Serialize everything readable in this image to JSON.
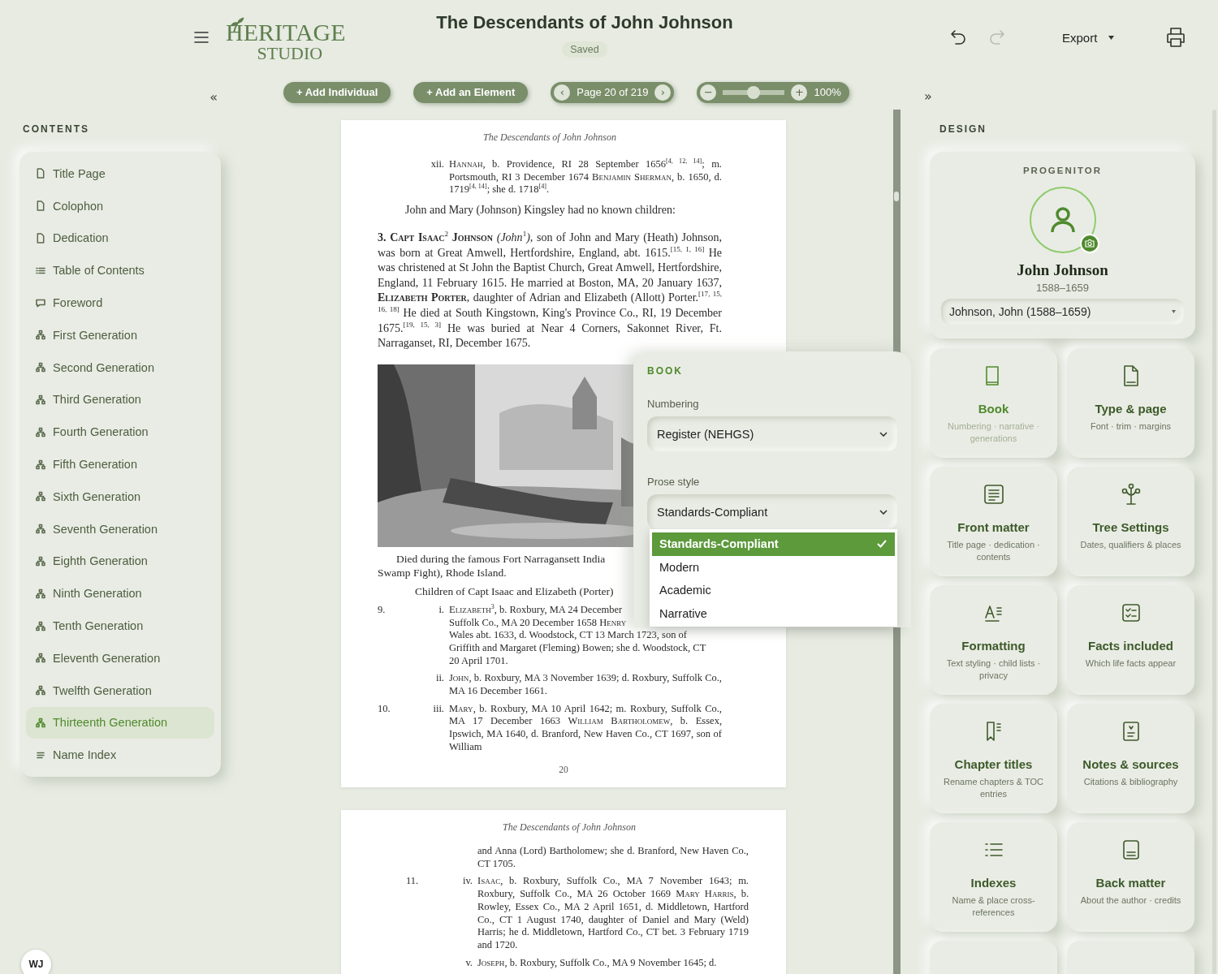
{
  "header": {
    "title": "The Descendants of John Johnson",
    "status": "Saved",
    "logo": {
      "line1": "HERITAGE",
      "line2": "STUDIO"
    },
    "undo": {
      "disabled": false
    },
    "redo": {
      "disabled": true
    },
    "export": "Export"
  },
  "toolbar": {
    "collapse_left": "«",
    "add_individual": "+ Add Individual",
    "add_element": "+ Add an Element",
    "page_prev": "‹",
    "page_label": "Page 20 of 219",
    "page_next": "›",
    "zoom_out": "−",
    "zoom": {
      "level": 0.49
    },
    "zoom_in": "+",
    "zoom_reading": "100%",
    "expand_right": "»"
  },
  "contents": {
    "title": "CONTENTS",
    "items": [
      {
        "label": "Title Page",
        "kind": "page",
        "selected": false
      },
      {
        "label": "Colophon",
        "kind": "page",
        "selected": false
      },
      {
        "label": "Dedication",
        "kind": "page",
        "selected": false
      },
      {
        "label": "Table of Contents",
        "kind": "toc",
        "selected": false
      },
      {
        "label": "Foreword",
        "kind": "comment",
        "selected": false
      },
      {
        "label": "First Generation",
        "kind": "generation",
        "selected": false
      },
      {
        "label": "Second Generation",
        "kind": "generation",
        "selected": false
      },
      {
        "label": "Third Generation",
        "kind": "generation",
        "selected": false
      },
      {
        "label": "Fourth Generation",
        "kind": "generation",
        "selected": false
      },
      {
        "label": "Fifth Generation",
        "kind": "generation",
        "selected": false
      },
      {
        "label": "Sixth Generation",
        "kind": "generation",
        "selected": false
      },
      {
        "label": "Seventh Generation",
        "kind": "generation",
        "selected": false
      },
      {
        "label": "Eighth Generation",
        "kind": "generation",
        "selected": false
      },
      {
        "label": "Ninth Generation",
        "kind": "generation",
        "selected": false
      },
      {
        "label": "Tenth Generation",
        "kind": "generation",
        "selected": false
      },
      {
        "label": "Eleventh Generation",
        "kind": "generation",
        "selected": false
      },
      {
        "label": "Twelfth Generation",
        "kind": "generation",
        "selected": false
      },
      {
        "label": "Thirteenth Generation",
        "kind": "generation",
        "selected": true
      },
      {
        "label": "Name Index",
        "kind": "index",
        "selected": false
      }
    ]
  },
  "document": {
    "pages": [
      {
        "header": "The Descendants of John Johnson",
        "page_number": "20",
        "paragraphs": [
          {
            "kind": "entry",
            "roman": "xii.",
            "runs": [
              {
                "kind": "name",
                "text": "Hannah"
              },
              {
                "kind": "plain",
                "text": ", b. Providence, RI 28 September 1656$^{[4, 12, 14]}$; m. Portsmouth, RI 3 December 1674 "
              },
              {
                "kind": "name",
                "text": "Benjamin Sherman"
              },
              {
                "kind": "plain",
                "text": ", b. 1650, d. 1719$^{[4, 14]}$; she d. 1718$^{[4]}$."
              }
            ]
          },
          {
            "kind": "note",
            "runs": [
              {
                "kind": "plain",
                "text": "John and Mary (Johnson) Kingsley had no known children:"
              }
            ]
          },
          {
            "kind": "bio",
            "runs": [
              {
                "kind": "plain",
                "text": "**3.** "
              },
              {
                "kind": "name",
                "text": "**Capt Isaac**$^{2}$ **Johnson**"
              },
              {
                "kind": "plain",
                "text": " *(John*$^{1}$*)*, son of John and Mary (Heath) Johnson, was born at Great Amwell, Hertfordshire, England, abt. 1615.$^{[15, 1, 16]}$ He was christened at St John the Baptist Church, Great Amwell, Hertfordshire, England, 11 February 1615. He married at Boston, MA, 20 January 1637, "
              },
              {
                "kind": "name",
                "text": "**Elizabeth Porter**"
              },
              {
                "kind": "plain",
                "text": ", daughter of Adrian and Elizabeth (Allott) Porter.$^{[17, 15, 16, 18]}$ He died at South Kingstown, King's Province Co., RI, 19 December 1675.$^{[19, 15, 3]}$ He was buried at Near 4 Corners, Sakonnet River, Ft. Narraganset, RI, December 1675."
              }
            ]
          },
          {
            "kind": "picture"
          },
          {
            "kind": "caption",
            "lines": [
              [
                {
                  "kind": "plain",
                  "text": "Died during the famous Fort Narragansett India"
                }
              ],
              [
                {
                  "kind": "plain",
                  "text": "Swamp Fight), Rhode Island."
                }
              ]
            ]
          },
          {
            "kind": "subheading",
            "lines": [
              [
                {
                  "kind": "plain",
                  "text": "Children of Capt Isaac and Elizabeth (Porter)"
                }
              ]
            ]
          },
          {
            "kind": "entry",
            "number": "9.",
            "roman": "i.",
            "lines": [
              [
                {
                  "kind": "name",
                  "text": "Elizabeth"
                },
                {
                  "kind": "plain",
                  "text": "$^{3}$, b. Roxbury, MA 24 December"
                }
              ],
              [
                {
                  "kind": "plain",
                  "text": "Suffolk Co., MA 20 December 1658 "
                },
                {
                  "kind": "name",
                  "text": "Henry"
                }
              ],
              [
                {
                  "kind": "plain",
                  "text": "Wales abt. 1633, d. Woodstock, CT 13 March 1723, son of"
                }
              ],
              [
                {
                  "kind": "plain",
                  "text": "Griffith and Margaret (Fleming) Bowen; she d. Woodstock, CT"
                }
              ],
              [
                {
                  "kind": "plain",
                  "text": "20 April 1701."
                }
              ]
            ]
          },
          {
            "kind": "entry",
            "roman": "ii.",
            "runs": [
              {
                "kind": "name",
                "text": "John"
              },
              {
                "kind": "plain",
                "text": ", b. Roxbury, MA 3 November 1639; d. Roxbury, Suffolk Co., MA 16 December 1661."
              }
            ]
          },
          {
            "kind": "entry",
            "number": "10.",
            "roman": "iii.",
            "runs": [
              {
                "kind": "name",
                "text": "Mary"
              },
              {
                "kind": "plain",
                "text": ", b. Roxbury, MA 10 April 1642; m. Roxbury, Suffolk Co., MA 17 December 1663 "
              },
              {
                "kind": "name",
                "text": "William Bartholomew"
              },
              {
                "kind": "plain",
                "text": ", b. Essex, Ipswich, MA 1640, d. Branford, New Haven Co., CT 1697, son of William"
              }
            ]
          }
        ]
      },
      {
        "header": "The Descendants of John Johnson",
        "paragraphs": [
          {
            "kind": "entry",
            "runs": [
              {
                "kind": "plain",
                "text": "and Anna (Lord) Bartholomew; she d. Branford, New Haven Co., CT 1705."
              }
            ]
          },
          {
            "kind": "entry",
            "number": "11.",
            "roman": "iv.",
            "runs": [
              {
                "kind": "name",
                "text": "Isaac"
              },
              {
                "kind": "plain",
                "text": ", b. Roxbury, Suffolk Co., MA 7 November 1643; m. Roxbury, Suffolk Co., MA 26 October 1669 "
              },
              {
                "kind": "name",
                "text": "Mary Harris"
              },
              {
                "kind": "plain",
                "text": ", b. Rowley, Essex Co., MA 2 April 1651, d. Middletown, Hartford Co., CT 1 August 1740, daughter of Daniel and Mary (Weld) Harris; he d. Middletown, Hartford Co., CT bet. 3 February 1719 and 1720."
              }
            ]
          },
          {
            "kind": "entry",
            "roman": "v.",
            "runs": [
              {
                "kind": "name",
                "text": "Joseph"
              },
              {
                "kind": "plain",
                "text": ", b. Roxbury, Suffolk Co., MA 9 November 1645; d."
              }
            ]
          }
        ]
      }
    ]
  },
  "book_panel": {
    "title": "BOOK",
    "numbering_label": "Numbering",
    "numbering_value": "Register (NEHGS)",
    "prose_label": "Prose style",
    "prose_value": "Standards-Compliant",
    "options": [
      {
        "label": "Standards-Compliant",
        "selected": true
      },
      {
        "label": "Modern",
        "selected": false
      },
      {
        "label": "Academic",
        "selected": false
      },
      {
        "label": "Narrative",
        "selected": false
      }
    ]
  },
  "design": {
    "title": "DESIGN",
    "progenitor": {
      "label": "PROGENITOR",
      "name": "John Johnson",
      "dates": "1588–1659",
      "select_value": "Johnson, John (1588–1659)"
    },
    "cards": [
      {
        "kind": "full",
        "title": "Book",
        "subtitle": "Numbering · narrative · generations",
        "selected": true
      },
      {
        "kind": "full",
        "title": "Type & page",
        "subtitle": "Font · trim · margins",
        "selected": false
      },
      {
        "kind": "full",
        "title": "Front matter",
        "subtitle": "Title page · dedication · contents",
        "selected": false
      },
      {
        "kind": "full",
        "title": "Tree Settings",
        "subtitle": "Dates, qualifiers & places",
        "selected": false
      },
      {
        "kind": "full",
        "title": "Formatting",
        "subtitle": "Text styling · child lists · privacy",
        "selected": false
      },
      {
        "kind": "full",
        "title": "Facts included",
        "subtitle": "Which life facts appear",
        "selected": false
      },
      {
        "kind": "full",
        "title": "Chapter titles",
        "subtitle": "Rename chapters & TOC entries",
        "selected": false
      },
      {
        "kind": "full",
        "title": "Notes & sources",
        "subtitle": "Citations & bibliography",
        "selected": false
      },
      {
        "kind": "full",
        "title": "Indexes",
        "subtitle": "Name & place cross-references",
        "selected": false
      },
      {
        "kind": "full",
        "title": "Back matter",
        "subtitle": "About the author · credits",
        "selected": false
      },
      {
        "kind": "partial"
      },
      {
        "kind": "partial"
      }
    ]
  },
  "user": {
    "initials": "WJ"
  }
}
